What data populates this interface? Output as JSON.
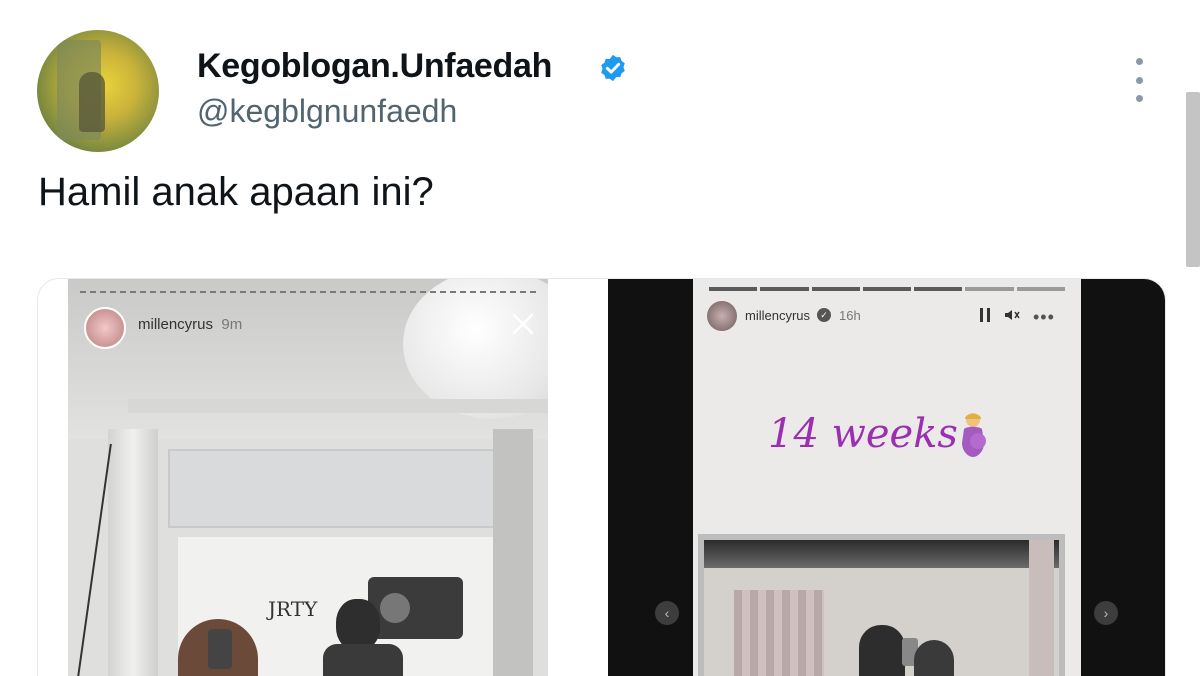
{
  "tweet": {
    "display_name": "Kegoblogan.Unfaedah",
    "handle": "@kegblgnunfaedh",
    "text": "Hamil anak apaan ini?",
    "verified": true,
    "accent_color": "#1d9bf0"
  },
  "media": {
    "left_story": {
      "username": "millencyrus",
      "time": "9m",
      "wall_art_text": "JRTY"
    },
    "right_story": {
      "username": "millencyrus",
      "time": "16h",
      "caption": "14 weeks",
      "caption_color": "#9b2fb2",
      "caption_emoji": "pregnant-woman-emoji"
    }
  },
  "icons": {
    "more": "more-vertical-icon",
    "verified": "verified-badge-icon",
    "close": "close-icon",
    "pause": "pause-icon",
    "mute": "mute-icon",
    "nav_prev": "chevron-left-icon",
    "nav_next": "chevron-right-icon"
  }
}
